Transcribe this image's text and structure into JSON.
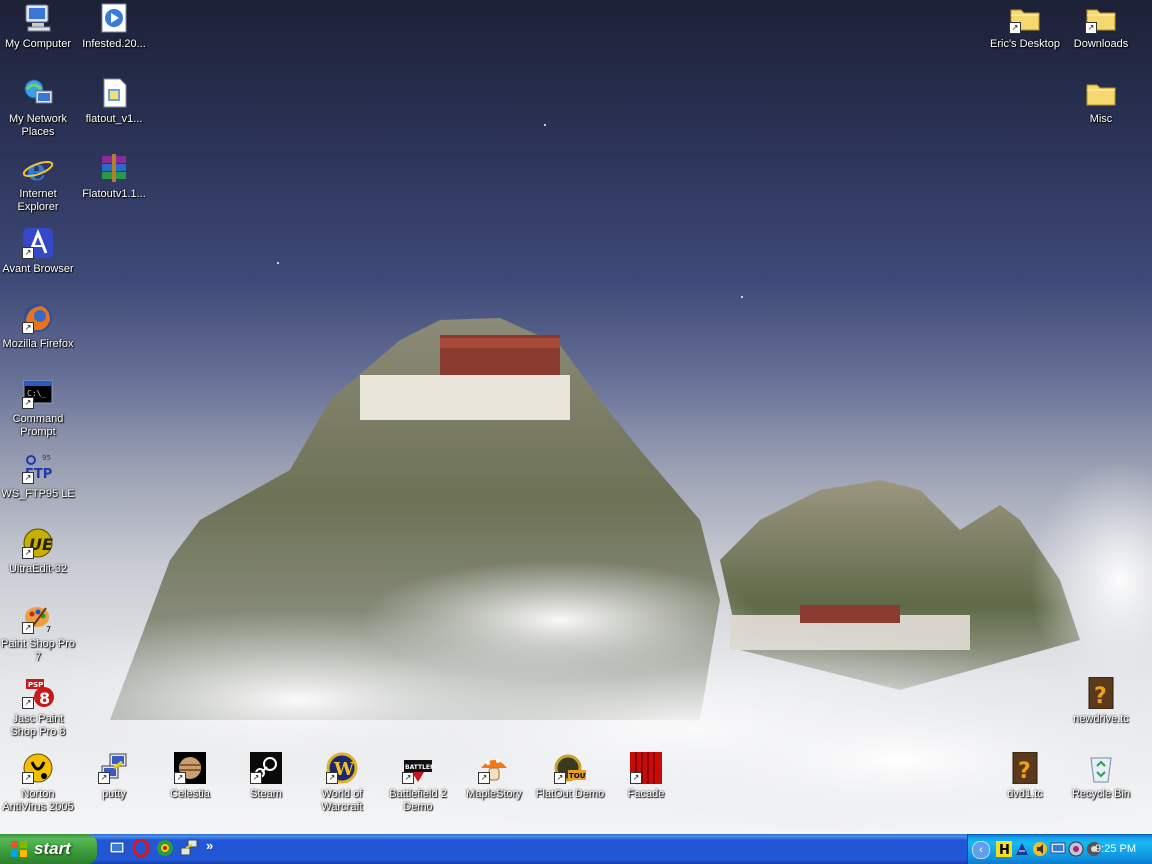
{
  "desktop": {
    "icons_left": [
      {
        "label": "My Computer"
      },
      {
        "label": "My Network Places"
      },
      {
        "label": "Internet Explorer"
      },
      {
        "label": "Avant Browser"
      },
      {
        "label": "Mozilla Firefox"
      },
      {
        "label": "Command Prompt"
      },
      {
        "label": "WS_FTP95 LE"
      },
      {
        "label": "UltraEdit-32"
      },
      {
        "label": "Paint Shop Pro 7"
      },
      {
        "label": "Jasc Paint Shop Pro 8"
      },
      {
        "label": "Norton AntiVirus 2005"
      }
    ],
    "icons_second_column": [
      {
        "label": "Infested.20..."
      },
      {
        "label": "flatout_v1..."
      },
      {
        "label": "Flatoutv1.1..."
      }
    ],
    "icons_bottom_row": [
      {
        "label": "putty"
      },
      {
        "label": "Celestia"
      },
      {
        "label": "Steam"
      },
      {
        "label": "World of Warcraft"
      },
      {
        "label": "Battlefield 2 Demo"
      },
      {
        "label": "MapleStory"
      },
      {
        "label": "FlatOut Demo"
      },
      {
        "label": "Facade"
      }
    ],
    "icons_right": [
      {
        "label": "Eric's Desktop"
      },
      {
        "label": "Downloads"
      },
      {
        "label": "Misc"
      },
      {
        "label": "newdrive.tc"
      },
      {
        "label": "dvd1.tc"
      },
      {
        "label": "Recycle Bin"
      }
    ]
  },
  "taskbar": {
    "start_label": "start",
    "quick_launch": [
      "show-desktop-icon",
      "opera-icon",
      "browser-icon",
      "network-icon"
    ],
    "tray_icons": [
      "h-icon",
      "network-status-icon",
      "speaker-icon",
      "monitor-icon",
      "messenger-icon",
      "antivirus-icon"
    ],
    "clock": "9:25 PM",
    "chevron": "»"
  },
  "colors": {
    "taskbar_blue": "#2157d7",
    "start_green": "#3a9b3a",
    "tray_blue": "#0f93e0"
  }
}
